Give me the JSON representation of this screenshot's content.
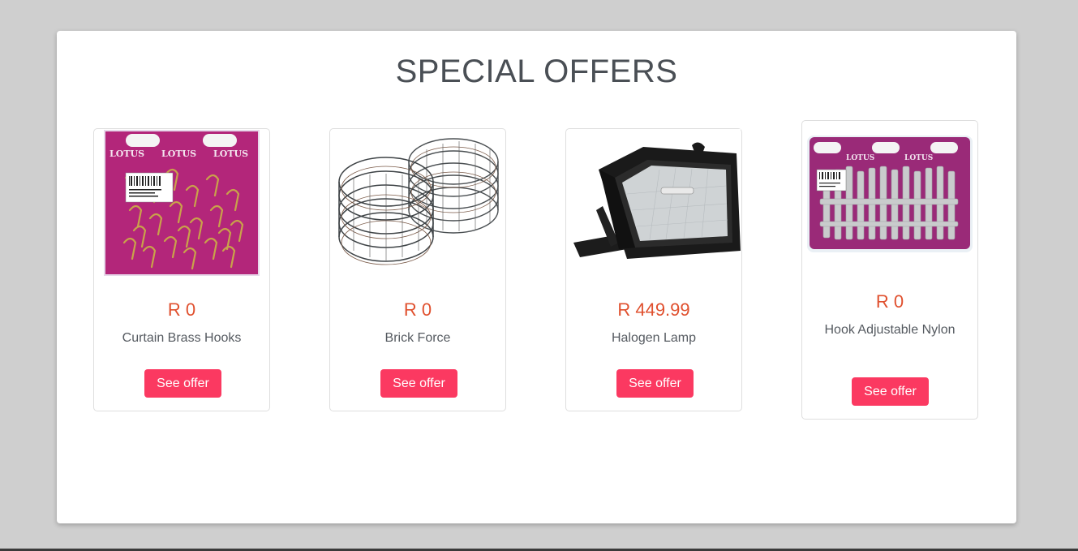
{
  "page": {
    "title": "SPECIAL OFFERS"
  },
  "colors": {
    "price": "#e0502e",
    "button_bg": "#fb3961",
    "button_text": "#ffffff",
    "title": "#4a4f55"
  },
  "products": [
    {
      "price": "R 0",
      "name": "Curtain Brass Hooks",
      "button_label": "See offer",
      "image": "brass-hooks-pack"
    },
    {
      "price": "R 0",
      "name": "Brick Force",
      "button_label": "See offer",
      "image": "wire-coils"
    },
    {
      "price": "R 449.99",
      "name": "Halogen Lamp",
      "button_label": "See offer",
      "image": "halogen-floodlight"
    },
    {
      "price": "R 0",
      "name": "Hook Adjustable Nylon",
      "button_label": "See offer",
      "image": "nylon-hooks-pack"
    }
  ],
  "brand_text": "LOTUS"
}
